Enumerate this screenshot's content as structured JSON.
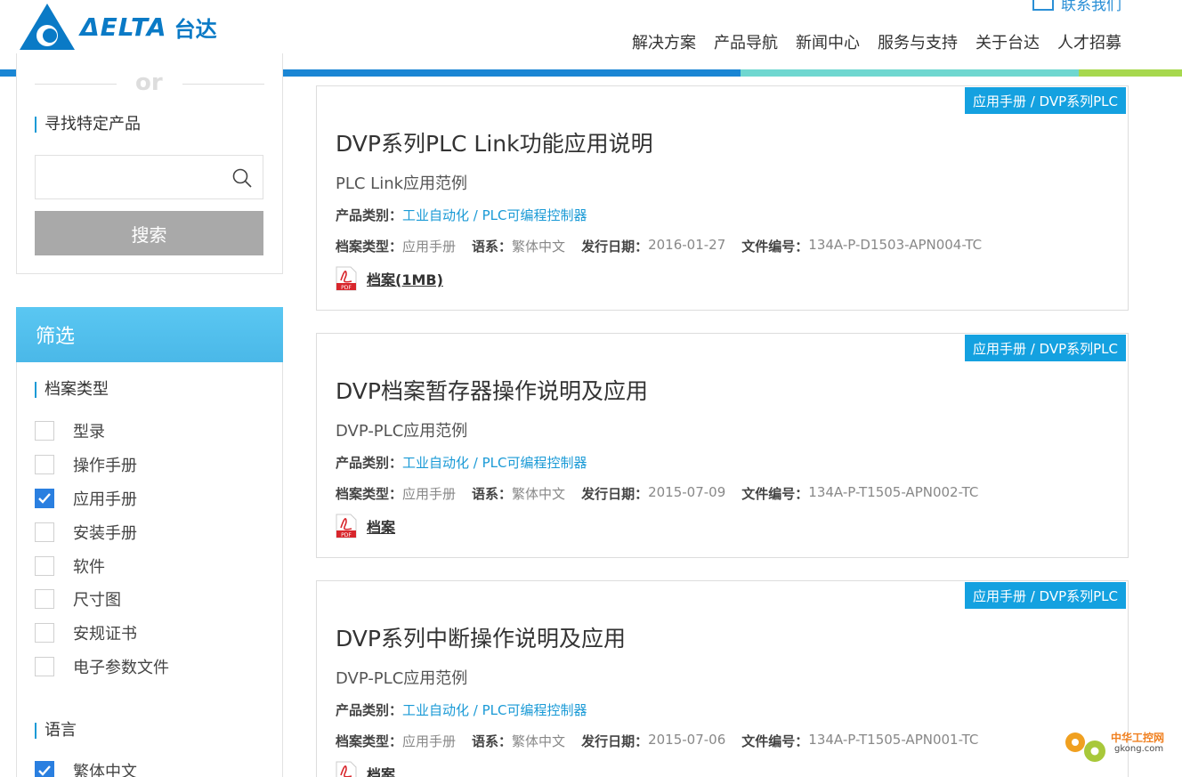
{
  "header": {
    "brand_word": "ΔELTA",
    "brand_cn": "台达",
    "contact_label": "联系我们",
    "nav": [
      "解决方案",
      "产品导航",
      "新闻中心",
      "服务与支持",
      "关于台达",
      "人才招募"
    ],
    "colors": {
      "bar_blue": "#1a86d4",
      "bar_teal": "#6fd7d0",
      "bar_green": "#a7d84e"
    }
  },
  "sidebar": {
    "or_text": "or",
    "search_title": "寻找特定产品",
    "search_input_value": "",
    "search_button": "搜索",
    "filter_title": "筛选",
    "doc_type_title": "档案类型",
    "doc_types": [
      {
        "label": "型录",
        "checked": false
      },
      {
        "label": "操作手册",
        "checked": false
      },
      {
        "label": "应用手册",
        "checked": true
      },
      {
        "label": "安装手册",
        "checked": false
      },
      {
        "label": "软件",
        "checked": false
      },
      {
        "label": "尺寸图",
        "checked": false
      },
      {
        "label": "安规证书",
        "checked": false
      },
      {
        "label": "电子参数文件",
        "checked": false
      }
    ],
    "language_title": "语言",
    "languages": [
      {
        "label": "繁体中文",
        "checked": true
      }
    ]
  },
  "labels": {
    "category": "产品类别：",
    "doc_type": "档案类型：",
    "language": "语系：",
    "date": "发行日期：",
    "doc_no": "文件编号："
  },
  "results": [
    {
      "tag": "应用手册 / DVP系列PLC",
      "title": "DVP系列PLC Link功能应用说明",
      "subtitle": "PLC Link应用范例",
      "category": "工业自动化 / PLC可编程控制器",
      "doc_type": "应用手册",
      "language": "繁体中文",
      "date": "2016-01-27",
      "doc_no": "134A-P-D1503-APN004-TC",
      "file_label": "档案(1MB)"
    },
    {
      "tag": "应用手册 / DVP系列PLC",
      "title": "DVP档案暂存器操作说明及应用",
      "subtitle": "DVP-PLC应用范例",
      "category": "工业自动化 / PLC可编程控制器",
      "doc_type": "应用手册",
      "language": "繁体中文",
      "date": "2015-07-09",
      "doc_no": "134A-P-T1505-APN002-TC",
      "file_label": "档案"
    },
    {
      "tag": "应用手册 / DVP系列PLC",
      "title": "DVP系列中断操作说明及应用",
      "subtitle": "DVP-PLC应用范例",
      "category": "工业自动化 / PLC可编程控制器",
      "doc_type": "应用手册",
      "language": "繁体中文",
      "date": "2015-07-06",
      "doc_no": "134A-P-T1505-APN001-TC",
      "file_label": "档案"
    }
  ],
  "watermark": {
    "name": "中华工控网",
    "domain": "gkong.com"
  }
}
